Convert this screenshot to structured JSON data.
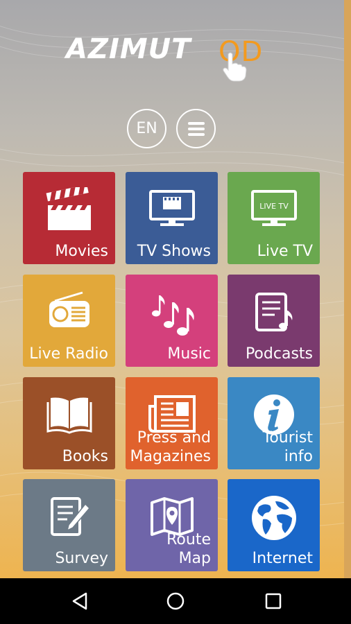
{
  "app": {
    "logo_text": "AZIMUT",
    "logo_suffix": "OD",
    "logo_accent_color": "#f39a1e"
  },
  "header": {
    "language_label": "EN",
    "menu_icon": "hamburger-menu-icon"
  },
  "tiles": [
    {
      "label": "Movies",
      "icon": "clapperboard-icon",
      "color": "#b72b35"
    },
    {
      "label": "TV Shows",
      "icon": "television-icon",
      "color": "#3b5c96"
    },
    {
      "label": "Live TV",
      "icon": "live-tv-icon",
      "color": "#6aa84f"
    },
    {
      "label": "Live Radio",
      "icon": "radio-icon",
      "color": "#e2a83a"
    },
    {
      "label": "Music",
      "icon": "music-notes-icon",
      "color": "#d4407c"
    },
    {
      "label": "Podcasts",
      "icon": "podcast-icon",
      "color": "#7a3a6e"
    },
    {
      "label": "Books",
      "icon": "open-book-icon",
      "color": "#9b5028"
    },
    {
      "label": "Press and\nMagazines",
      "icon": "newspaper-icon",
      "color": "#e0622d"
    },
    {
      "label": "Tourist\ninfo",
      "icon": "info-icon",
      "color": "#3a88c4"
    },
    {
      "label": "Survey",
      "icon": "survey-pen-icon",
      "color": "#6c7a87"
    },
    {
      "label": "Route\nMap",
      "icon": "map-pin-icon",
      "color": "#6f65a9"
    },
    {
      "label": "Internet",
      "icon": "globe-icon",
      "color": "#1a67c9"
    }
  ],
  "navbar": {
    "back_icon": "back-triangle-icon",
    "home_icon": "home-circle-icon",
    "recents_icon": "recents-square-icon"
  }
}
